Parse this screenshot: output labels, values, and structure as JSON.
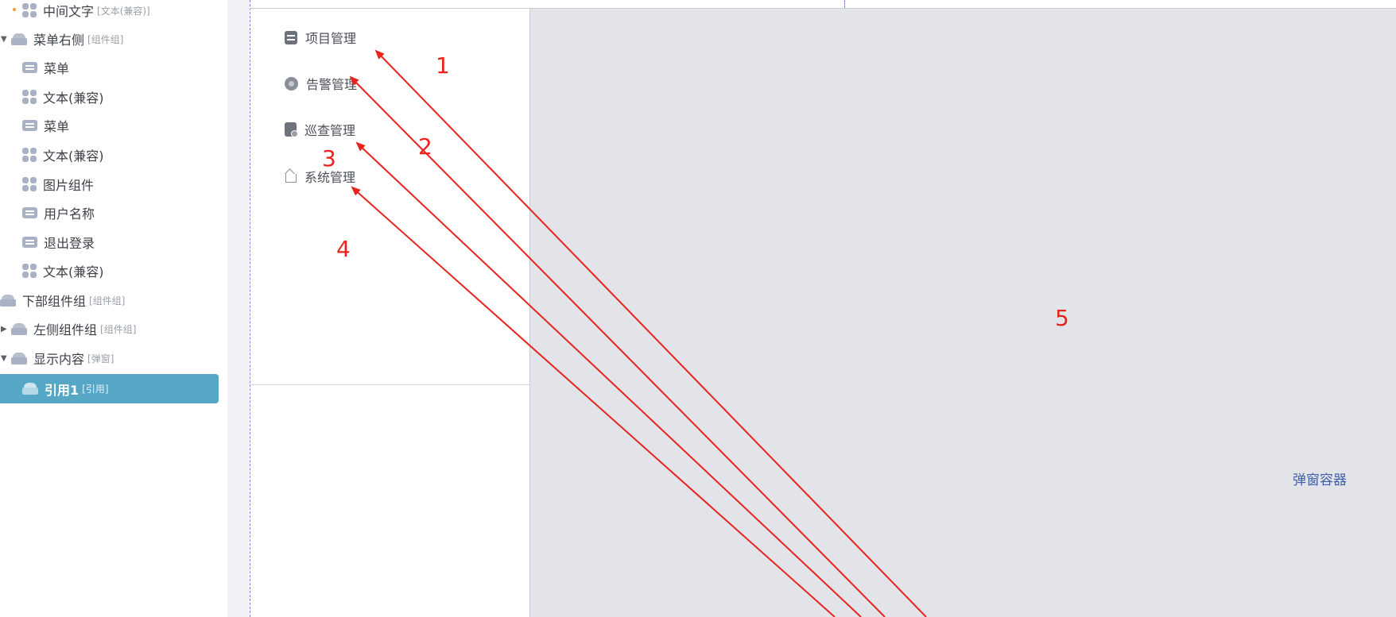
{
  "layer_tree": {
    "items": [
      {
        "label": "中间文字",
        "tag": "[文本(兼容)]",
        "icon": "text-component-icon"
      },
      {
        "label": "菜单右侧",
        "tag": "[组件组]",
        "icon": "component-group-icon",
        "expanded": true
      },
      {
        "label": "菜单",
        "tag": "",
        "icon": "menu-component-icon"
      },
      {
        "label": "文本(兼容)",
        "tag": "",
        "icon": "text-component-icon"
      },
      {
        "label": "菜单",
        "tag": "",
        "icon": "menu-component-icon"
      },
      {
        "label": "文本(兼容)",
        "tag": "",
        "icon": "text-component-icon"
      },
      {
        "label": "图片组件",
        "tag": "",
        "icon": "text-component-icon"
      },
      {
        "label": "用户名称",
        "tag": "",
        "icon": "menu-component-icon"
      },
      {
        "label": "退出登录",
        "tag": "",
        "icon": "menu-component-icon"
      },
      {
        "label": "文本(兼容)",
        "tag": "",
        "icon": "text-component-icon"
      },
      {
        "label": "下部组件组",
        "tag": "[组件组]",
        "icon": "component-group-icon"
      },
      {
        "label": "左侧组件组",
        "tag": "[组件组]",
        "icon": "component-group-icon",
        "expanded": false
      },
      {
        "label": "显示内容",
        "tag": "[弹窗]",
        "icon": "component-group-icon",
        "expanded": true
      },
      {
        "label": "引用1",
        "tag": "[引用]",
        "icon": "component-group-icon",
        "selected": true
      }
    ]
  },
  "canvas": {
    "menu_items": [
      {
        "label": "项目管理",
        "icon": "project-icon"
      },
      {
        "label": "告警管理",
        "icon": "alarm-icon"
      },
      {
        "label": "巡查管理",
        "icon": "patrol-icon"
      },
      {
        "label": "系统管理",
        "icon": "system-icon"
      }
    ],
    "popup_container_label": "弹窗容器"
  },
  "annotations": {
    "numbers": [
      "1",
      "2",
      "3",
      "4",
      "5"
    ],
    "color": "#e8231d"
  },
  "colors": {
    "selection": "#56a7c6",
    "popup_bg": "#e2e4ea",
    "popup_label": "#3f5fa8"
  }
}
